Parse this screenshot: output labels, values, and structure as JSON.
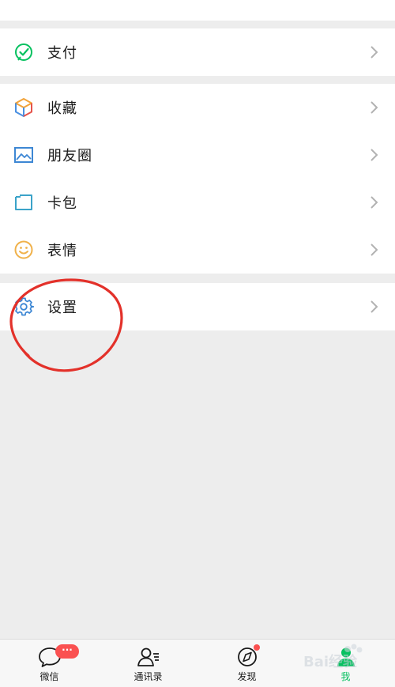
{
  "colors": {
    "accent": "#07c160",
    "badge": "#fa5151",
    "annotation": "#e3312a"
  },
  "menu": {
    "groups": [
      {
        "items": [
          {
            "label": "支付",
            "icon": "wallet-check-icon"
          }
        ]
      },
      {
        "items": [
          {
            "label": "收藏",
            "icon": "cube-icon"
          },
          {
            "label": "朋友圈",
            "icon": "image-icon"
          },
          {
            "label": "卡包",
            "icon": "card-icon"
          },
          {
            "label": "表情",
            "icon": "smiley-icon"
          }
        ]
      },
      {
        "items": [
          {
            "label": "设置",
            "icon": "gear-icon"
          }
        ]
      }
    ]
  },
  "tabbar": {
    "tabs": [
      {
        "label": "微信",
        "icon": "chat-bubble-icon",
        "badge": "···"
      },
      {
        "label": "通讯录",
        "icon": "contacts-icon"
      },
      {
        "label": "发现",
        "icon": "compass-icon"
      },
      {
        "label": "我",
        "icon": "person-icon",
        "active": true
      }
    ]
  },
  "watermark": {
    "text": "Bai经验"
  }
}
